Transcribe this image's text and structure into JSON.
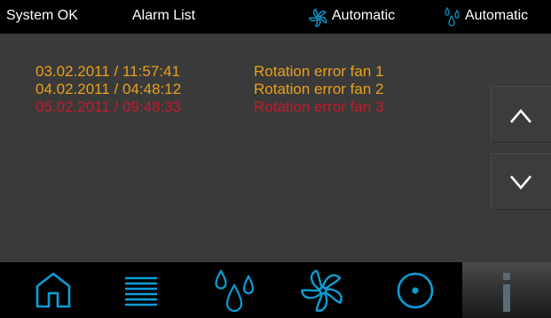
{
  "topbar": {
    "status": "System OK",
    "screen_title": "Alarm List",
    "fan_mode_icon": "fan-icon",
    "fan_mode": "Automatic",
    "humidity_mode_icon": "water-drops-icon",
    "humidity_mode": "Automatic"
  },
  "alarms": [
    {
      "timestamp": "03.02.2011 / 11:57:41",
      "message": "Rotation error fan 1",
      "color": "#e8a01c"
    },
    {
      "timestamp": "04.02.2011 / 04:48:12",
      "message": "Rotation error fan 2",
      "color": "#e8a01c"
    },
    {
      "timestamp": "05.02.2011 / 09:48:33",
      "message": "Rotation error fan 3",
      "color": "#c41a2a"
    }
  ],
  "scroll": {
    "up_icon": "chevron-up-icon",
    "down_icon": "chevron-down-icon"
  },
  "nav": [
    {
      "icon": "home-icon"
    },
    {
      "icon": "list-icon"
    },
    {
      "icon": "water-drops-icon"
    },
    {
      "icon": "fan-icon"
    },
    {
      "icon": "dot-circle-icon"
    },
    {
      "icon": "info-icon",
      "active": true
    }
  ],
  "colors": {
    "accent": "#0a9fd6",
    "warning": "#e8a01c",
    "error": "#c41a2a"
  }
}
